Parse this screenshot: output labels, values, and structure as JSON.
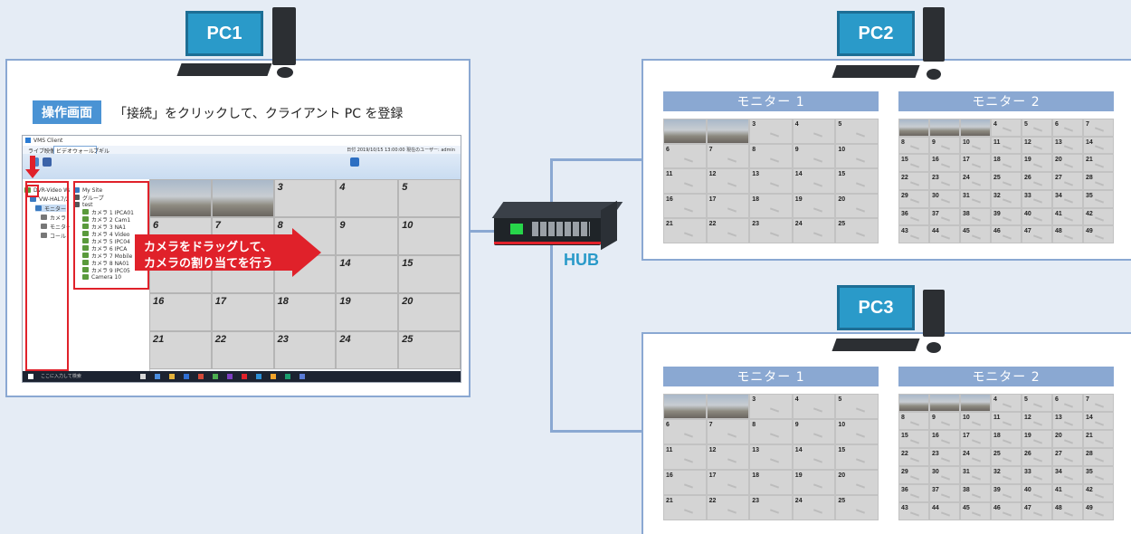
{
  "pcs": {
    "pc1": "PC1",
    "pc2": "PC2",
    "pc3": "PC3"
  },
  "hub": {
    "label": "HUB"
  },
  "pc1_panel": {
    "tag": "操作画面",
    "description": "「接続」をクリックして、クライアント PC を登録",
    "drag_text_line1": "カメラをドラッグして、",
    "drag_text_line2": "カメラの割り当てを行う"
  },
  "screenshot": {
    "window_title": "VMS Client",
    "menu": [
      "ライブ映像",
      "ビデオウォール",
      "プギル"
    ],
    "header_right": "日付 2019/10/15 13:00:00  現在のユーザー: admin",
    "tree_left": [
      "DVR-Video Wall Server",
      "VW-HAL7/2-06",
      "モニター",
      "カメラ",
      "モニター",
      "コール"
    ],
    "tree_cameras": [
      "My Site",
      "グループ",
      "test",
      "カメラ 1 IPCA01",
      "カメラ 2 Cam1",
      "カメラ 3 NA1",
      "カメラ 4 Video",
      "カメラ 5 IPC04",
      "カメラ 6 IPCA",
      "カメラ 7 Mobile",
      "カメラ 8 NA01",
      "カメラ 9 IPC05",
      "Camera 10"
    ],
    "grid_cells": [
      "",
      "",
      "3",
      "4",
      "5",
      "6",
      "7",
      "8",
      "9",
      "10",
      "11",
      "12",
      "13",
      "14",
      "15",
      "16",
      "17",
      "18",
      "19",
      "20",
      "21",
      "22",
      "23",
      "24",
      "25"
    ],
    "taskbar_search": "ここに入力して検索"
  },
  "monitors": {
    "pc2": {
      "m1_title": "モニター 1",
      "m2_title": "モニター 2"
    },
    "pc3": {
      "m1_title": "モニター 1",
      "m2_title": "モニター 2"
    }
  },
  "grid25": [
    "",
    "",
    "3",
    "4",
    "5",
    "6",
    "7",
    "8",
    "9",
    "10",
    "11",
    "12",
    "13",
    "14",
    "15",
    "16",
    "17",
    "18",
    "19",
    "20",
    "21",
    "22",
    "23",
    "24",
    "25"
  ],
  "grid49": [
    "",
    "",
    "",
    "4",
    "5",
    "6",
    "7",
    "8",
    "9",
    "10",
    "11",
    "12",
    "13",
    "14",
    "15",
    "16",
    "17",
    "18",
    "19",
    "20",
    "21",
    "22",
    "23",
    "24",
    "25",
    "26",
    "27",
    "28",
    "29",
    "30",
    "31",
    "32",
    "33",
    "34",
    "35",
    "36",
    "37",
    "38",
    "39",
    "40",
    "41",
    "42",
    "43",
    "44",
    "45",
    "46",
    "47",
    "48",
    "49"
  ],
  "colors": {
    "accent": "#2a9ac9",
    "line": "#8aa8d2",
    "red": "#e0212a"
  }
}
